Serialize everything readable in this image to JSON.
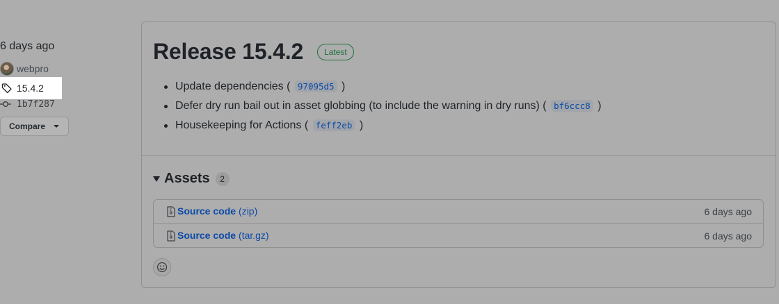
{
  "meta": {
    "published": "6 days ago",
    "author": "webpro",
    "tag": "15.4.2",
    "commit": "1b7f287",
    "compare_label": "Compare"
  },
  "release": {
    "title": "Release 15.4.2",
    "badge": "Latest",
    "notes": [
      {
        "text": "Update dependencies (",
        "sha": "97095d5",
        "close": ")"
      },
      {
        "text": "Defer dry run bail out in asset globbing (to include the warning in dry runs) (",
        "sha": "bf6ccc8",
        "close": ")"
      },
      {
        "text": "Housekeeping for Actions (",
        "sha": "feff2eb",
        "close": ")"
      }
    ]
  },
  "assets": {
    "title": "Assets",
    "count": "2",
    "items": [
      {
        "name": "Source code",
        "ext": "(zip)",
        "time": "6 days ago"
      },
      {
        "name": "Source code",
        "ext": "(tar.gz)",
        "time": "6 days ago"
      }
    ]
  },
  "colors": {
    "background": "#adadad",
    "link": "#0b4aa8",
    "badge_green": "#1f6f3f",
    "tag_highlight": "#ffffff"
  },
  "icons": [
    "tag-icon",
    "commit-icon",
    "file-zip-icon",
    "smiley-icon",
    "chevron-down-icon"
  ]
}
